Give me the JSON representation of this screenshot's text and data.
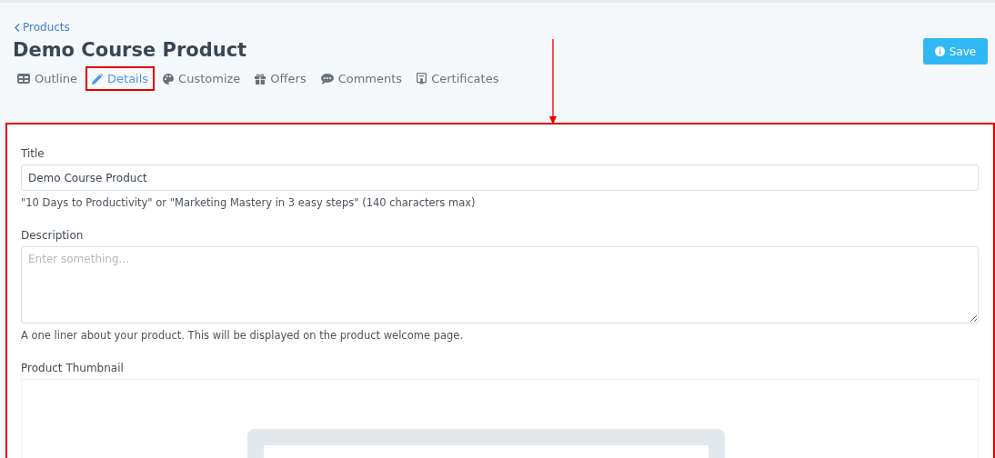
{
  "breadcrumb": {
    "label": "Products"
  },
  "title": "Demo Course Product",
  "save_button": {
    "label": "Save"
  },
  "tabs": [
    {
      "kind": "outline",
      "label": "Outline",
      "selected": false,
      "annotated": false
    },
    {
      "kind": "details",
      "label": "Details",
      "selected": true,
      "annotated": true
    },
    {
      "kind": "customize",
      "label": "Customize",
      "selected": false,
      "annotated": false
    },
    {
      "kind": "offers",
      "label": "Offers",
      "selected": false,
      "annotated": false
    },
    {
      "kind": "comments",
      "label": "Comments",
      "selected": false,
      "annotated": false
    },
    {
      "kind": "certificates",
      "label": "Certificates",
      "selected": false,
      "annotated": false
    }
  ],
  "annotation": {
    "arrow": true,
    "frame": true
  },
  "form": {
    "title_field": {
      "label": "Title",
      "value": "Demo Course Product",
      "help": "\"10 Days to Productivity\" or \"Marketing Mastery in 3 easy steps\" (140 characters max)"
    },
    "description_field": {
      "label": "Description",
      "placeholder": "Enter something...",
      "help": "A one liner about your product. This will be displayed on the product welcome page."
    },
    "thumbnail": {
      "label": "Product Thumbnail",
      "kind": "picture"
    }
  }
}
